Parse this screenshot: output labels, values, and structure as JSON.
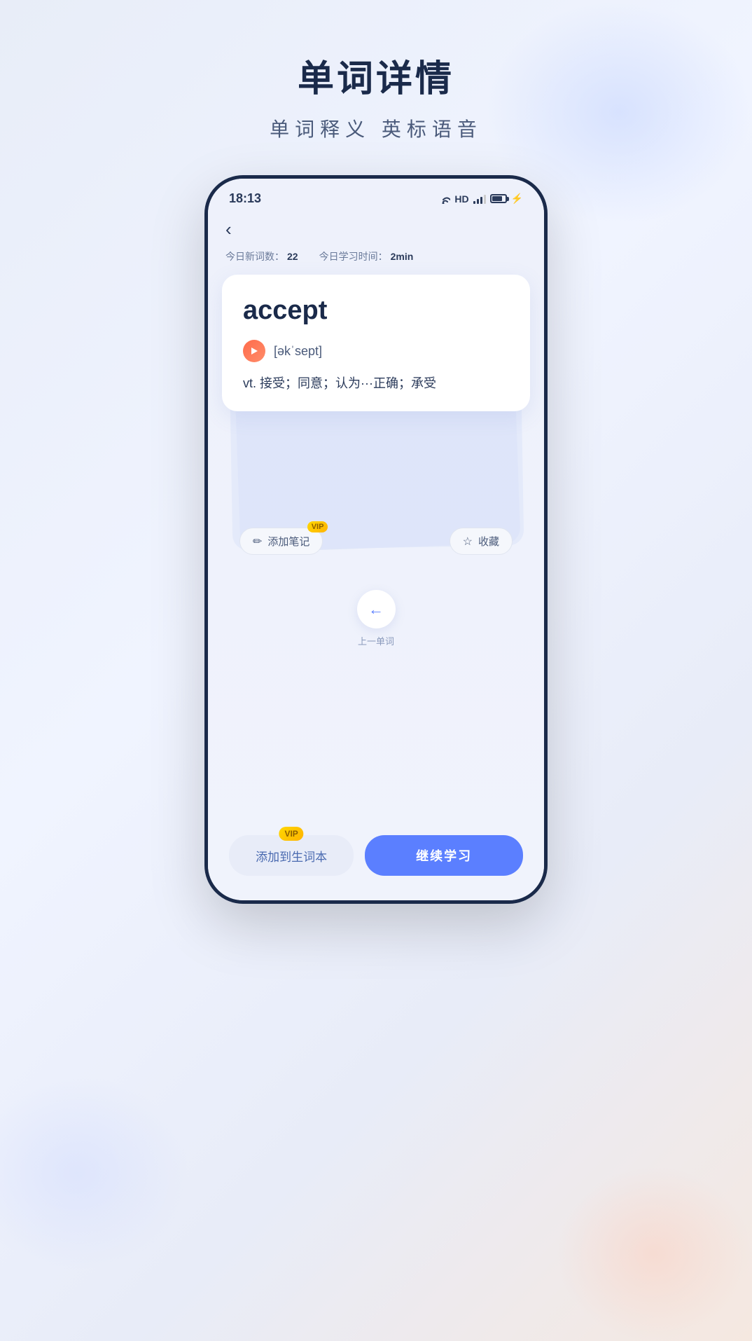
{
  "page": {
    "title": "单词详情",
    "subtitle": "单词释义 英标语音",
    "background_colors": {
      "main": "#e8edf8",
      "blob1": "rgba(200,215,255,0.6)",
      "blob2": "rgba(210,220,255,0.5)",
      "blob3": "rgba(255,200,180,0.4)"
    }
  },
  "status_bar": {
    "time": "18:13",
    "hd_label": "HD",
    "wifi_unicode": "📶"
  },
  "nav": {
    "back_arrow": "‹"
  },
  "stats": {
    "new_words_label": "今日新词数：",
    "new_words_value": "22",
    "study_time_label": "今日学习时间：",
    "study_time_value": "2min"
  },
  "word_card": {
    "word": "accept",
    "phonetic": "[əkˈsept]",
    "phonetic_icon": "》",
    "definition": "vt. 接受；同意；认为···正确；承受"
  },
  "actions": {
    "add_note_label": "添加笔记",
    "add_note_icon": "✏",
    "collect_label": "收藏",
    "collect_icon": "☆",
    "vip_label": "VIP"
  },
  "navigation": {
    "prev_arrow": "←",
    "prev_label": "上一单词"
  },
  "bottom_buttons": {
    "add_wordbook_label": "添加到生词本",
    "continue_label": "继续学习",
    "vip_label": "VIP"
  }
}
